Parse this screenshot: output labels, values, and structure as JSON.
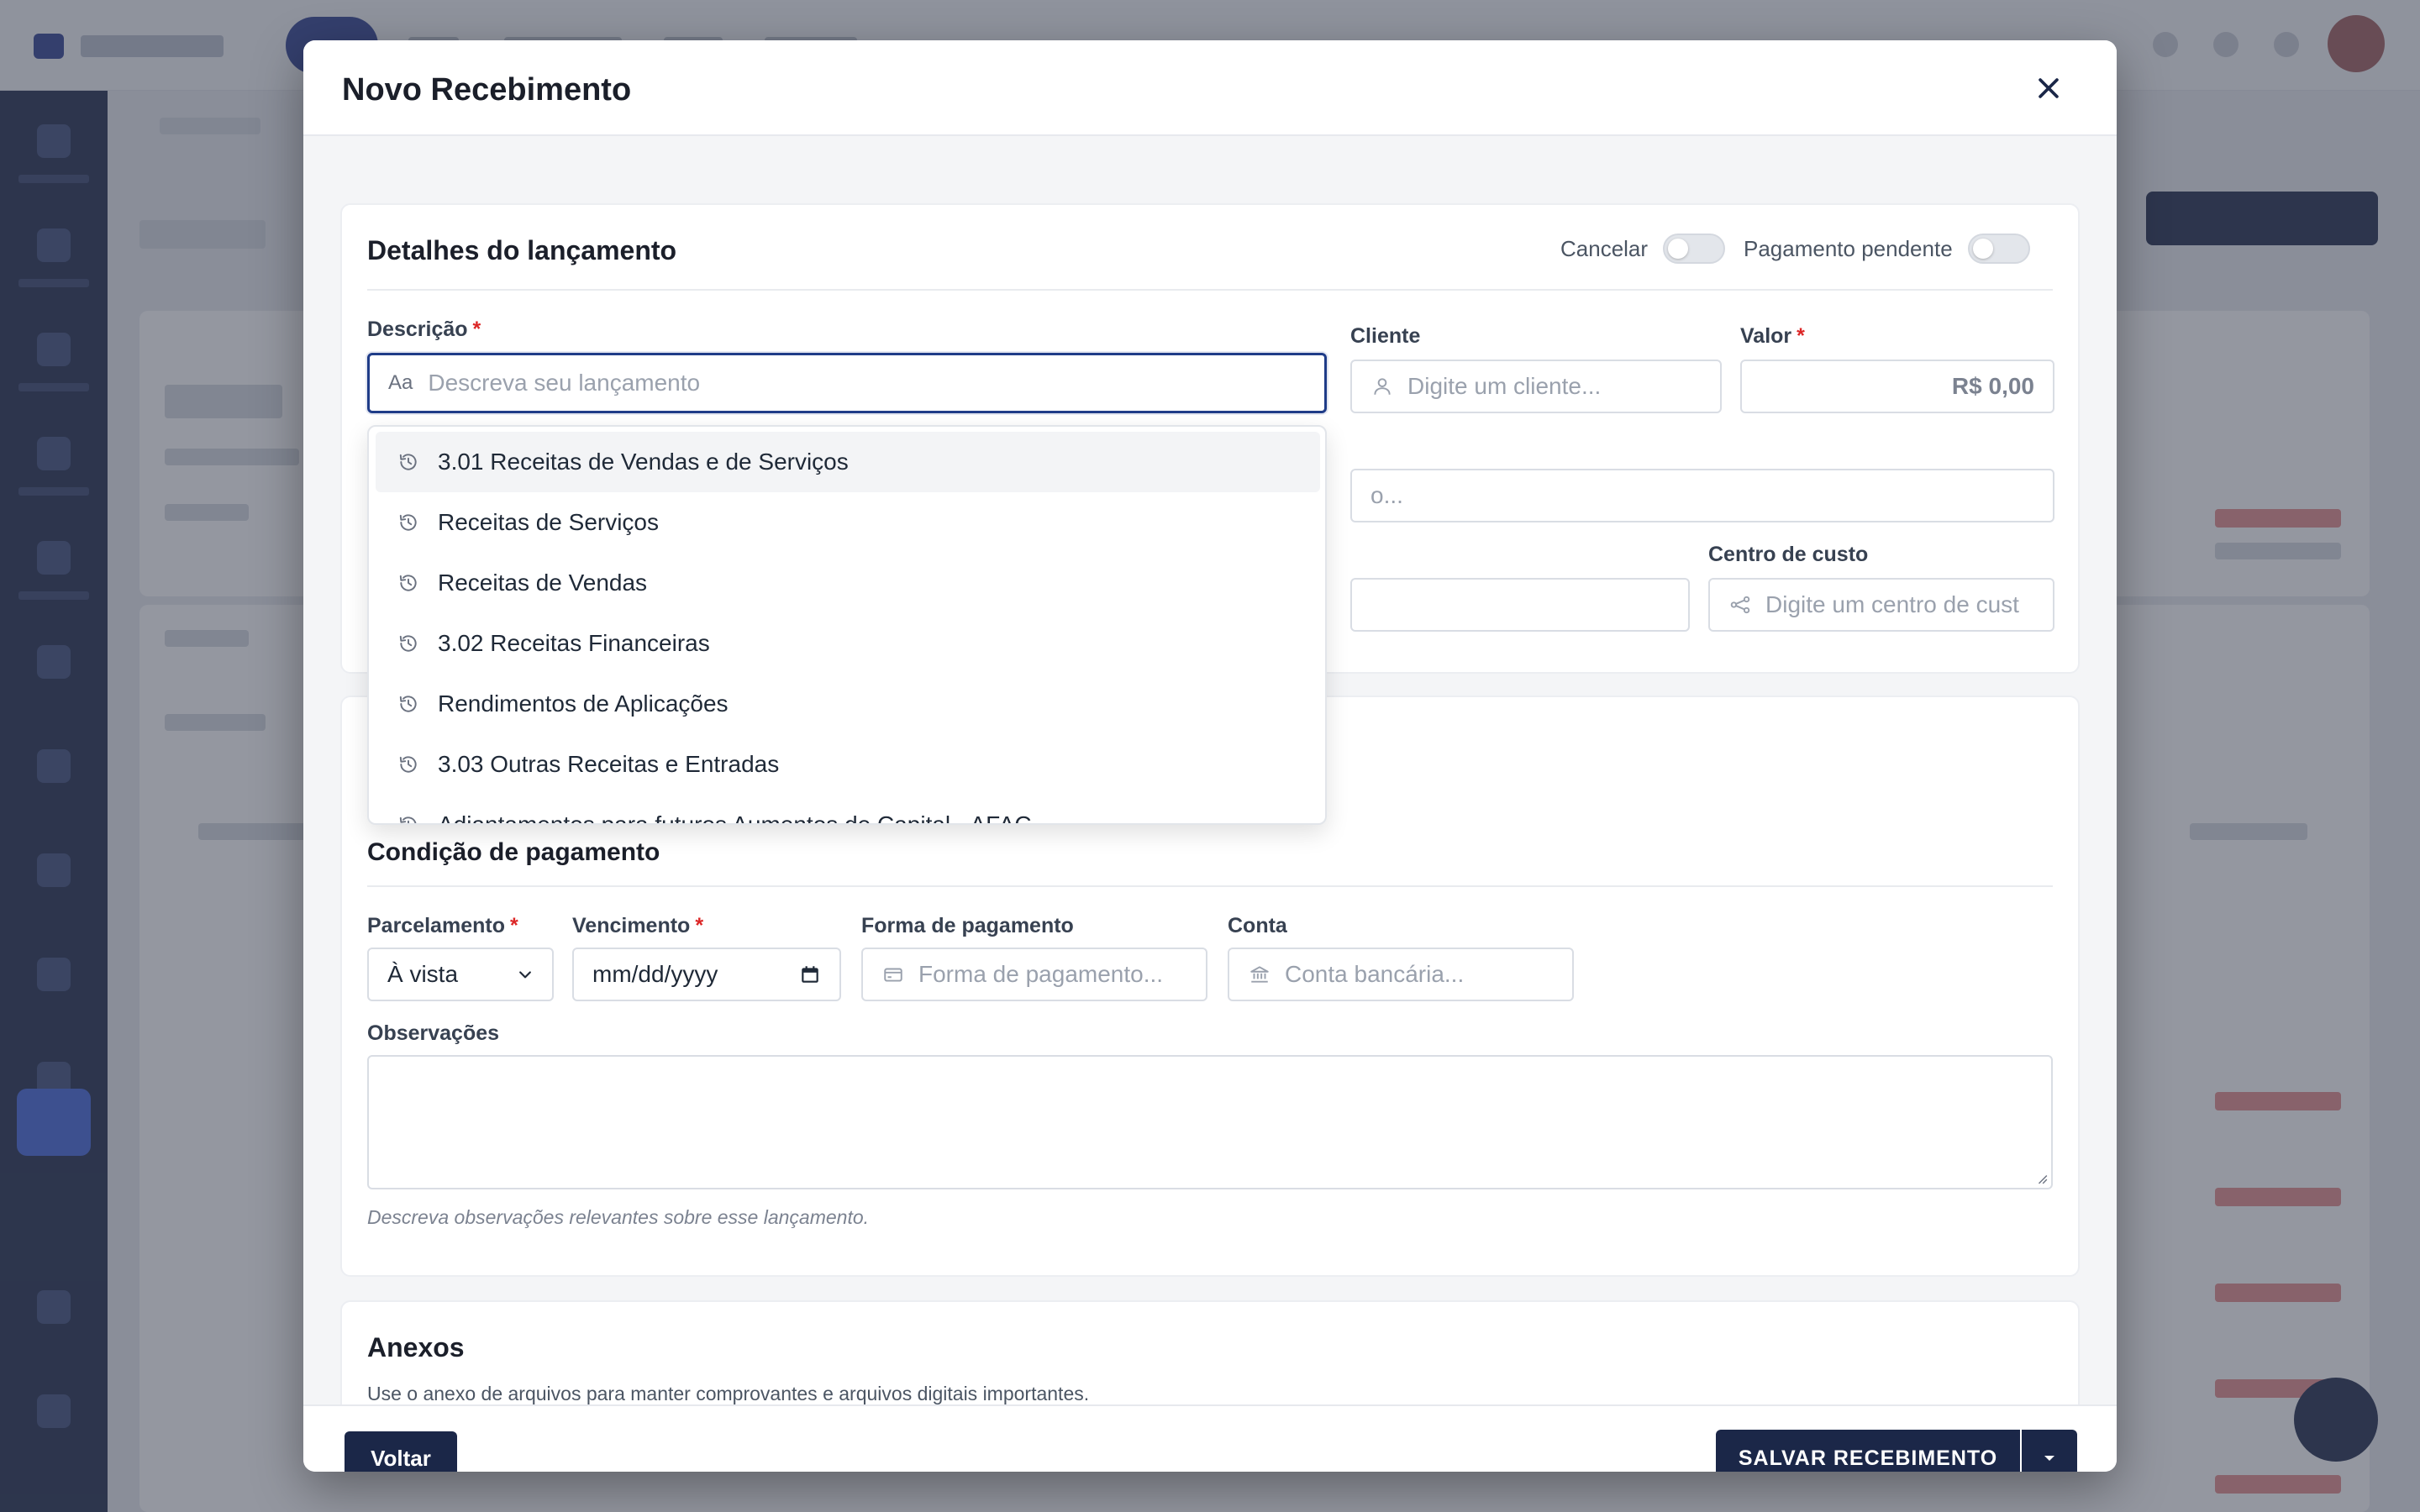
{
  "modal": {
    "title": "Novo Recebimento",
    "close_icon": "close-icon"
  },
  "details": {
    "title": "Detalhes do lançamento",
    "toggle_cancel_label": "Cancelar",
    "toggle_pending_label": "Pagamento pendente",
    "description_label": "Descrição",
    "description_placeholder": "Descreva seu lançamento",
    "description_icon_text": "Aa",
    "client_label": "Cliente",
    "client_placeholder": "Digite um cliente...",
    "value_label": "Valor",
    "value_text": "R$ 0,00",
    "category_partial_placeholder": "o...",
    "cost_center_label": "Centro de custo",
    "cost_center_placeholder": "Digite um centro de cust"
  },
  "dropdown": {
    "items": [
      "3.01 Receitas de Vendas e de Serviços",
      "Receitas de Serviços",
      "Receitas de Vendas",
      "3.02 Receitas Financeiras",
      "Rendimentos de Aplicações",
      "3.03 Outras Receitas e Entradas",
      "Adiantamentos para futuros Aumentos de Capital - AFAC"
    ]
  },
  "payment": {
    "title": "Condição de pagamento",
    "installments_label": "Parcelamento",
    "installments_value": "À vista",
    "due_label": "Vencimento",
    "due_placeholder": "mm/dd/yyyy",
    "method_label": "Forma de pagamento",
    "method_placeholder": "Forma de pagamento...",
    "account_label": "Conta",
    "account_placeholder": "Conta bancária...",
    "notes_label": "Observações",
    "notes_hint": "Descreva observações relevantes sobre esse lançamento."
  },
  "attachments": {
    "title": "Anexos",
    "description": "Use o anexo de arquivos para manter comprovantes e arquivos digitais importantes."
  },
  "footer": {
    "back_label": "Voltar",
    "save_label": "SALVAR RECEBIMENTO"
  },
  "colors": {
    "primary": "#1b2748",
    "focus": "#1f3c88",
    "required": "#dc2626"
  }
}
